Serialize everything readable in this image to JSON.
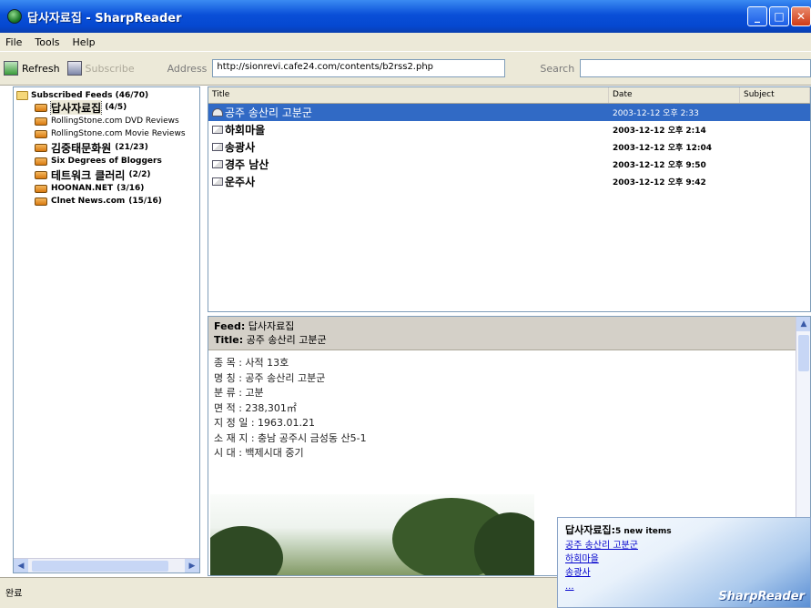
{
  "window": {
    "title": "답사자료집 - SharpReader"
  },
  "menu": [
    "File",
    "Tools",
    "Help"
  ],
  "toolbar": {
    "refresh_label": "Refresh",
    "subscribe_label": "Subscribe",
    "address_label": "Address",
    "address_value": "http://sionrevi.cafe24.com/contents/b2rss2.php",
    "search_label": "Search"
  },
  "sidebar": {
    "root_label": "Subscribed Feeds (46/70)",
    "feeds": [
      {
        "name": "답사자료집",
        "count": "(4/5)"
      },
      {
        "name": "RollingStone.com DVD Reviews",
        "count": ""
      },
      {
        "name": "RollingStone.com Movie Reviews",
        "count": ""
      },
      {
        "name": "김중태문화원",
        "count": "(21/23)"
      },
      {
        "name": "Six Degrees of Bloggers",
        "count": ""
      },
      {
        "name": "테트워크 클러리",
        "count": "(2/2)"
      },
      {
        "name": "HOONAN.NET",
        "count": "(3/16)"
      },
      {
        "name": "Clnet News.com",
        "count": "(15/16)"
      }
    ]
  },
  "list": {
    "columns": [
      "Title",
      "Date",
      "Subject"
    ],
    "rows": [
      {
        "title": "공주 송산리 고분군",
        "date": "2003-12-12 오후 2:33"
      },
      {
        "title": "하회마을",
        "date": "2003-12-12 오후 2:14"
      },
      {
        "title": "송광사",
        "date": "2003-12-12 오후 12:04"
      },
      {
        "title": "경주 남산",
        "date": "2003-12-12 오후 9:50"
      },
      {
        "title": "운주사",
        "date": "2003-12-12 오후 9:42"
      }
    ]
  },
  "preview": {
    "feed_label": "Feed:",
    "feed_value": "답사자료집",
    "title_label": "Title:",
    "title_value": "공주 송산리 고분군",
    "lines": [
      "종 목 : 사적 13호",
      "명 칭 : 공주 송산리 고분군",
      "분 류 : 고분",
      "면 적 : 238,301㎡",
      "지 정 일 : 1963.01.21",
      "소 재 지 : 충남 공주시 금성동 산5-1",
      "시 대 : 백제시대 중기"
    ]
  },
  "status": {
    "text": "완료"
  },
  "popup": {
    "title": "답사자료집:",
    "subtitle": "5 new items",
    "links": [
      "공주 송산리 고분군",
      "하회마을",
      "송광사",
      "..."
    ],
    "brand": "SharpReader"
  }
}
